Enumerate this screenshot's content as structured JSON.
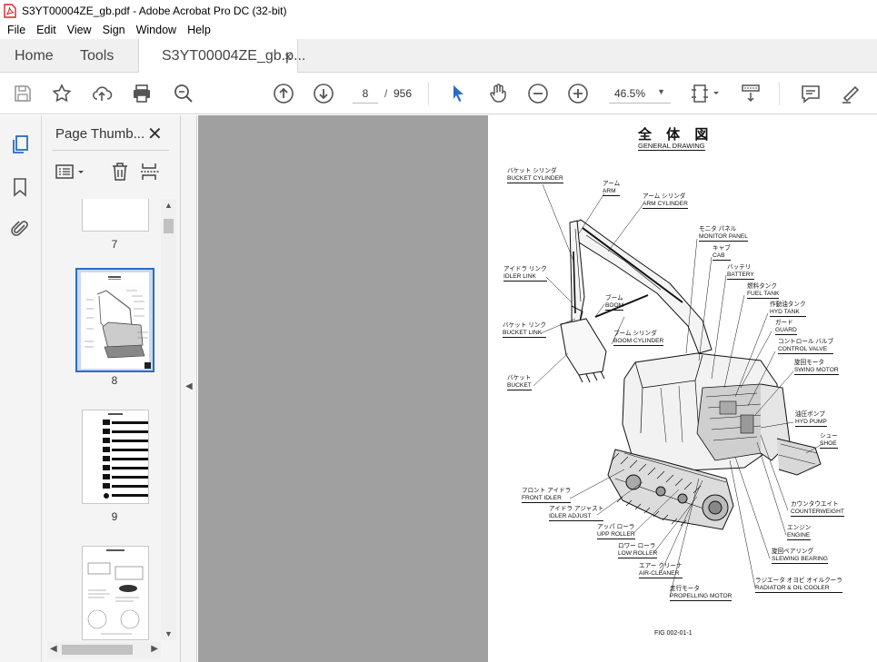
{
  "window": {
    "title": "S3YT00004ZE_gb.pdf - Adobe Acrobat Pro DC (32-bit)"
  },
  "menu": [
    "File",
    "Edit",
    "View",
    "Sign",
    "Window",
    "Help"
  ],
  "tabs": {
    "home": "Home",
    "tools": "Tools",
    "document": "S3YT00004ZE_gb.p...",
    "close": "×"
  },
  "toolbar": {
    "current_page": "8",
    "page_separator": "/",
    "total_pages": "956",
    "zoom": "46.5%"
  },
  "thumbnails": {
    "title": "Page Thumb...",
    "close": "✕",
    "pages": [
      {
        "num": "7"
      },
      {
        "num": "8"
      },
      {
        "num": "9"
      },
      {
        "num": ""
      }
    ]
  },
  "drawing": {
    "title_jp": "全 体 図",
    "title_en": "GENERAL DRAWING",
    "figure": "FIG 002-01-1",
    "labels": [
      {
        "jp": "バケット シリンダ",
        "en": "BUCKET CYLINDER"
      },
      {
        "jp": "アーム",
        "en": "ARM"
      },
      {
        "jp": "アーム シリンダ",
        "en": "ARM CYLINDER"
      },
      {
        "jp": "モニタ パネル",
        "en": "MONITOR PANEL"
      },
      {
        "jp": "キャブ",
        "en": "CAB"
      },
      {
        "jp": "バッテリ",
        "en": "BATTERY"
      },
      {
        "jp": "燃料タンク",
        "en": "FUEL TANK"
      },
      {
        "jp": "作動油タンク",
        "en": "HYD TANK"
      },
      {
        "jp": "ガード",
        "en": "GUARD"
      },
      {
        "jp": "コントロール バルブ",
        "en": "CONTROL VALVE"
      },
      {
        "jp": "旋回モータ",
        "en": "SWING MOTOR"
      },
      {
        "jp": "油圧ポンプ",
        "en": "HYD PUMP"
      },
      {
        "jp": "シュー",
        "en": "SHOE"
      },
      {
        "jp": "カウンタウエイト",
        "en": "COUNTERWEIGHT"
      },
      {
        "jp": "エンジン",
        "en": "ENGINE"
      },
      {
        "jp": "旋回ベアリング",
        "en": "SLEWING BEARING"
      },
      {
        "jp": "ラジエータ オヨビ オイルクーラ",
        "en": "RADIATOR & OIL COOLER"
      },
      {
        "jp": "走行モータ",
        "en": "PROPELLING MOTOR"
      },
      {
        "jp": "エアー クリーナ",
        "en": "AIR-CLEANER"
      },
      {
        "jp": "ロワー ローラ",
        "en": "LOW ROLLER"
      },
      {
        "jp": "アッパ ローラ",
        "en": "UPP ROLLER"
      },
      {
        "jp": "アイドラ アジャスト",
        "en": "IDLER ADJUST"
      },
      {
        "jp": "フロント アイドラ",
        "en": "FRONT IDLER"
      },
      {
        "jp": "バケット",
        "en": "BUCKET"
      },
      {
        "jp": "ブーム シリンダ",
        "en": "BOOM CYLINDER"
      },
      {
        "jp": "バケット リンク",
        "en": "BUCKET LINK"
      },
      {
        "jp": "ブーム",
        "en": "BOOM"
      },
      {
        "jp": "アイドラ リンク",
        "en": "IDLER LINK"
      }
    ]
  },
  "colors": {
    "acrobat_red": "#d4242a",
    "doc_bg": "#a0a0a0",
    "selected_thumb": "#2b6cc4",
    "nav_blue": "#2b6cc4"
  }
}
